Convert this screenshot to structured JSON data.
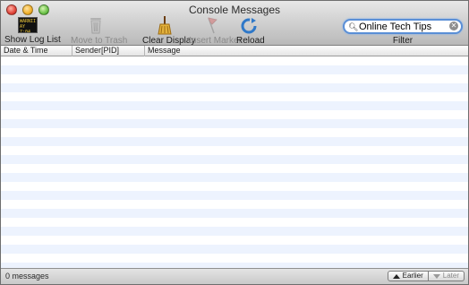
{
  "window": {
    "title": "Console Messages"
  },
  "toolbar": {
    "show_log_list": {
      "label": "Show Log List",
      "icon_text": "WARNII\nAY 7:04",
      "icon": "log-list-icon"
    },
    "move_to_trash": {
      "label": "Move to Trash",
      "icon": "trash-icon",
      "enabled": false
    },
    "clear_display": {
      "label": "Clear Display",
      "icon": "broom-icon"
    },
    "insert_marker": {
      "label": "Insert Marker",
      "icon": "marker-flag-icon",
      "enabled": false
    },
    "reload": {
      "label": "Reload",
      "icon": "reload-icon"
    }
  },
  "filter": {
    "label": "Filter",
    "value": "Online Tech Tips"
  },
  "table": {
    "columns": [
      "Date & Time",
      "Sender[PID]",
      "Message"
    ],
    "rows": []
  },
  "status": {
    "message_count": "0 messages",
    "earlier_label": "Earlier",
    "later_label": "Later"
  },
  "colors": {
    "stripe": "#edf3fe",
    "search_focus": "#5a8fd6"
  }
}
